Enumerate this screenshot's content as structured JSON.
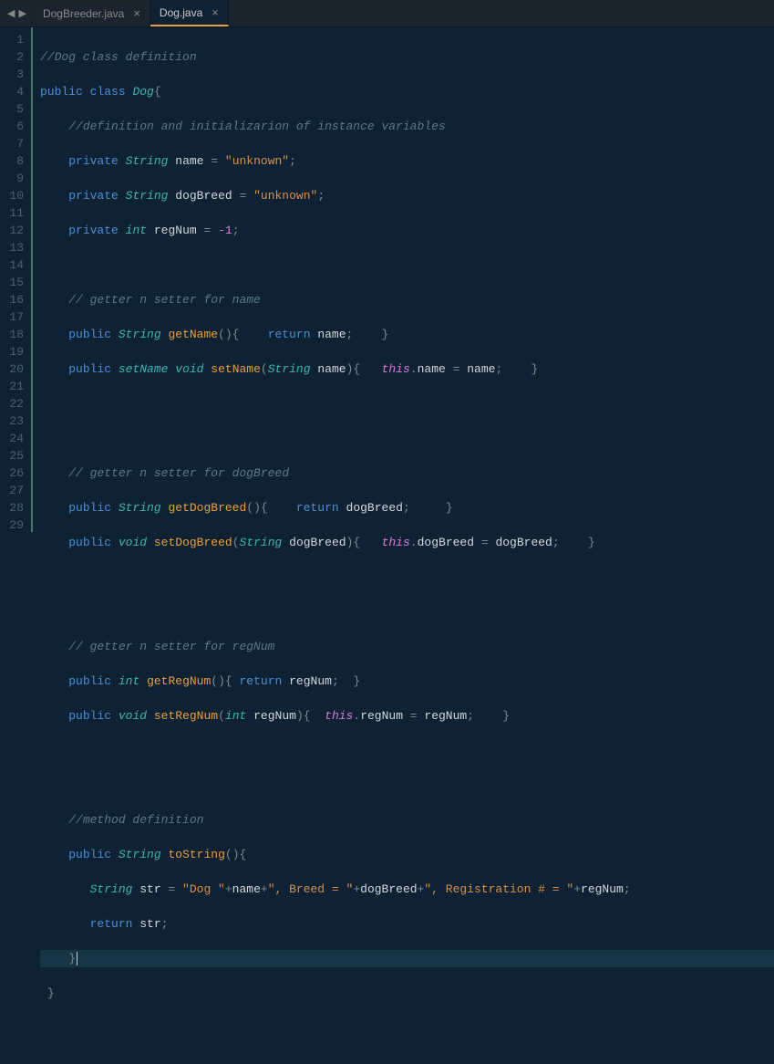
{
  "tabs": [
    {
      "label": "DogBreeder.java",
      "active": false
    },
    {
      "label": "Dog.java",
      "active": true
    }
  ],
  "line_count": 29,
  "current_line": 27,
  "code": {
    "l1": {
      "comment": "//Dog class definition"
    },
    "l2": {
      "kw1": "public",
      "kw2": "class",
      "name": "Dog",
      "brace": "{"
    },
    "l3": {
      "comment": "//definition and initializarion of instance variables"
    },
    "l4": {
      "kw": "private",
      "type": "String",
      "var": "name",
      "op": " = ",
      "str": "\"unknown\"",
      "semi": ";"
    },
    "l5": {
      "kw": "private",
      "type": "String",
      "var": "dogBreed",
      "op": " = ",
      "str": "\"unknown\"",
      "semi": ";"
    },
    "l6": {
      "kw": "private",
      "type": "int",
      "var": "regNum",
      "op": " = ",
      "num": "-1",
      "semi": ";"
    },
    "l8": {
      "comment": "// getter n setter for name"
    },
    "l9": {
      "kw": "public",
      "type": "String",
      "method": "getName",
      "parens": "(){    ",
      "ret": "return",
      "var": "name",
      "rest": ";    }"
    },
    "l10": {
      "kw": "public",
      "type": "void",
      "method": "setName",
      "open": "(",
      "ptype": "String",
      "pvar": "name",
      "close": "){   ",
      "this": "this",
      "dot": ".",
      "field": "name",
      "op": " = ",
      "rhs": "name",
      "rest": ";    }"
    },
    "l13": {
      "comment": "// getter n setter for dogBreed"
    },
    "l14": {
      "kw": "public",
      "type": "String",
      "method": "getDogBreed",
      "parens": "(){    ",
      "ret": "return",
      "var": "dogBreed",
      "rest": ";     }"
    },
    "l15": {
      "kw": "public",
      "type": "void",
      "method": "setDogBreed",
      "open": "(",
      "ptype": "String",
      "pvar": "dogBreed",
      "close": "){   ",
      "this": "this",
      "dot": ".",
      "field": "dogBreed",
      "op": " = ",
      "rhs": "dogBreed",
      "rest": ";    }"
    },
    "l18": {
      "comment": "// getter n setter for regNum"
    },
    "l19": {
      "kw": "public",
      "type": "int",
      "method": "getRegNum",
      "parens": "(){ ",
      "ret": "return",
      "var": "regNum",
      "rest": ";  }"
    },
    "l20": {
      "kw": "public",
      "type": "void",
      "method": "setRegNum",
      "open": "(",
      "ptype": "int",
      "pvar": "regNum",
      "close": "){  ",
      "this": "this",
      "dot": ".",
      "field": "regNum",
      "op": " = ",
      "rhs": "regNum",
      "rest": ";    }"
    },
    "l23": {
      "comment": "//method definition"
    },
    "l24": {
      "kw": "public",
      "type": "String",
      "method": "toString",
      "parens": "(){"
    },
    "l25": {
      "type": "String",
      "var": "str",
      "op": " = ",
      "s1": "\"Dog \"",
      "p1": "+",
      "v1": "name",
      "p2": "+",
      "s2": "\", Breed = \"",
      "p3": "+",
      "v2": "dogBreed",
      "p4": "+",
      "s3": "\", Registration # = \"",
      "p5": "+",
      "v3": "regNum",
      "semi": ";"
    },
    "l26": {
      "ret": "return",
      "var": "str",
      "semi": ";"
    },
    "l27": {
      "brace": "}"
    },
    "l28": {
      "brace": "}"
    }
  }
}
